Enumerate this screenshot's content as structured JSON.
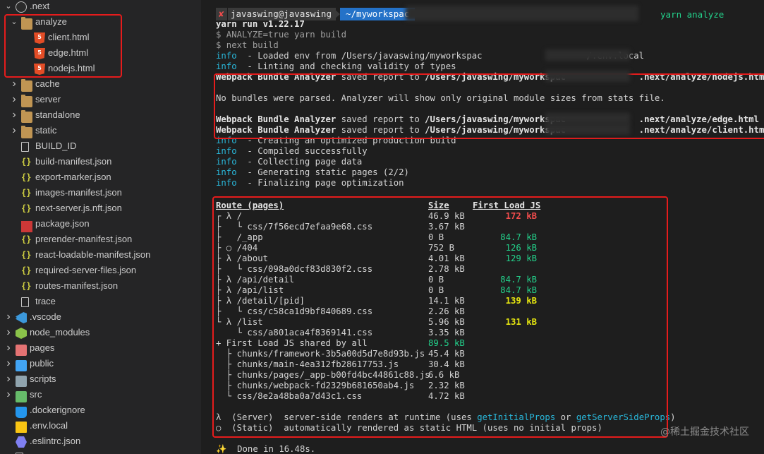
{
  "sidebar": {
    "root": ".next",
    "items": [
      {
        "label": ".next",
        "kind": "next",
        "indent": 0,
        "chevron": "down"
      },
      {
        "label": "analyze",
        "kind": "folder",
        "indent": 1,
        "chevron": "down"
      },
      {
        "label": "client.html",
        "kind": "html",
        "indent": 2,
        "chevron": ""
      },
      {
        "label": "edge.html",
        "kind": "html",
        "indent": 2,
        "chevron": ""
      },
      {
        "label": "nodejs.html",
        "kind": "html",
        "indent": 2,
        "chevron": ""
      },
      {
        "label": "cache",
        "kind": "folder",
        "indent": 1,
        "chevron": "right"
      },
      {
        "label": "server",
        "kind": "folder",
        "indent": 1,
        "chevron": "right"
      },
      {
        "label": "standalone",
        "kind": "folder",
        "indent": 1,
        "chevron": "right"
      },
      {
        "label": "static",
        "kind": "folder",
        "indent": 1,
        "chevron": "right"
      },
      {
        "label": "BUILD_ID",
        "kind": "file",
        "indent": 1,
        "chevron": ""
      },
      {
        "label": "build-manifest.json",
        "kind": "json",
        "indent": 1,
        "chevron": ""
      },
      {
        "label": "export-marker.json",
        "kind": "json",
        "indent": 1,
        "chevron": ""
      },
      {
        "label": "images-manifest.json",
        "kind": "json",
        "indent": 1,
        "chevron": ""
      },
      {
        "label": "next-server.js.nft.json",
        "kind": "json",
        "indent": 1,
        "chevron": ""
      },
      {
        "label": "package.json",
        "kind": "npm",
        "indent": 1,
        "chevron": ""
      },
      {
        "label": "prerender-manifest.json",
        "kind": "json",
        "indent": 1,
        "chevron": ""
      },
      {
        "label": "react-loadable-manifest.json",
        "kind": "json",
        "indent": 1,
        "chevron": ""
      },
      {
        "label": "required-server-files.json",
        "kind": "json",
        "indent": 1,
        "chevron": ""
      },
      {
        "label": "routes-manifest.json",
        "kind": "json",
        "indent": 1,
        "chevron": ""
      },
      {
        "label": "trace",
        "kind": "file",
        "indent": 1,
        "chevron": ""
      },
      {
        "label": ".vscode",
        "kind": "vscode",
        "indent": 0,
        "chevron": "right"
      },
      {
        "label": "node_modules",
        "kind": "nm",
        "indent": 0,
        "chevron": "right"
      },
      {
        "label": "pages",
        "kind": "redfolder",
        "indent": 0,
        "chevron": "right"
      },
      {
        "label": "public",
        "kind": "bluefolder",
        "indent": 0,
        "chevron": "right"
      },
      {
        "label": "scripts",
        "kind": "greyfolder",
        "indent": 0,
        "chevron": "right"
      },
      {
        "label": "src",
        "kind": "greenfolder",
        "indent": 0,
        "chevron": "right"
      },
      {
        "label": ".dockerignore",
        "kind": "docker",
        "indent": 0,
        "chevron": ""
      },
      {
        "label": ".env.local",
        "kind": "env",
        "indent": 0,
        "chevron": ""
      },
      {
        "label": ".eslintrc.json",
        "kind": "eslint",
        "indent": 0,
        "chevron": ""
      },
      {
        "label": "...",
        "kind": "file",
        "indent": 0,
        "chevron": ""
      }
    ]
  },
  "terminal": {
    "prompt": {
      "status": "✘",
      "user": "javaswing@javaswing",
      "dir": "~/myworkspac",
      "command": "yarn analyze"
    },
    "lines": [
      {
        "text": "yarn run v1.22.17",
        "cls": "bold"
      },
      {
        "text": "$ ANALYZE=true yarn build",
        "cls": "dim"
      },
      {
        "text": "$ next build",
        "cls": "dim"
      },
      {
        "prefix": "info",
        "text": "  - Loaded env from /Users/javaswing/myworkspac                    /.env.local"
      },
      {
        "prefix": "info",
        "text": "  - Linting and checking validity of types"
      },
      {
        "bold": "Webpack Bundle Analyzer",
        "text": " saved report to ",
        "path": "/Users/javaswing/myworkspac              .next/analyze/nodejs.html"
      },
      {
        "text": ""
      },
      {
        "text": "No bundles were parsed. Analyzer will show only original module sizes from stats file."
      },
      {
        "text": ""
      },
      {
        "bold": "Webpack Bundle Analyzer",
        "text": " saved report to ",
        "path": "/Users/javaswing/myworkspac              .next/analyze/edge.html"
      },
      {
        "bold": "Webpack Bundle Analyzer",
        "text": " saved report to ",
        "path": "/Users/javaswing/myworkspac              .next/analyze/client.html"
      },
      {
        "prefix": "info",
        "text": "  - Creating an optimized production build"
      },
      {
        "prefix": "info",
        "text": "  - Compiled successfully"
      },
      {
        "prefix": "info",
        "text": "  - Collecting page data"
      },
      {
        "prefix": "info",
        "text": "  - Generating static pages (2/2)"
      },
      {
        "prefix": "info",
        "text": "  - Finalizing page optimization"
      }
    ],
    "route_header": {
      "route": "Route (pages)",
      "size": "Size",
      "first_load": "First Load JS"
    },
    "routes": [
      {
        "tree": "┌ λ /",
        "size": "46.9 kB",
        "fl": "172 kB",
        "flc": "redtxt"
      },
      {
        "tree": "├   └ css/7f56ecd7efaa9e68.css",
        "size": "3.67 kB",
        "fl": "",
        "flc": ""
      },
      {
        "tree": "├   /_app",
        "size": "0 B",
        "fl": "84.7 kB",
        "flc": "green"
      },
      {
        "tree": "├ ○ /404",
        "size": "752 B",
        "fl": "126 kB",
        "flc": "green"
      },
      {
        "tree": "├ λ /about",
        "size": "4.01 kB",
        "fl": "129 kB",
        "flc": "green"
      },
      {
        "tree": "├   └ css/098a0dcf83d830f2.css",
        "size": "2.78 kB",
        "fl": "",
        "flc": ""
      },
      {
        "tree": "├ λ /api/detail",
        "size": "0 B",
        "fl": "84.7 kB",
        "flc": "green"
      },
      {
        "tree": "├ λ /api/list",
        "size": "0 B",
        "fl": "84.7 kB",
        "flc": "green"
      },
      {
        "tree": "├ λ /detail/[pid]",
        "size": "14.1 kB",
        "fl": "139 kB",
        "flc": "yellow"
      },
      {
        "tree": "├   └ css/c58ca1d9bf840689.css",
        "size": "2.26 kB",
        "fl": "",
        "flc": ""
      },
      {
        "tree": "└ λ /list",
        "size": "5.96 kB",
        "fl": "131 kB",
        "flc": "yellow"
      },
      {
        "tree": "    └ css/a801aca4f8369141.css",
        "size": "3.35 kB",
        "fl": "",
        "flc": ""
      },
      {
        "tree": "+ First Load JS shared by all",
        "size": "89.5 kB",
        "fl": "",
        "flc": "",
        "sizec": "green"
      },
      {
        "tree": "  ├ chunks/framework-3b5a00d5d7e8d93b.js",
        "size": "45.4 kB",
        "fl": "",
        "flc": ""
      },
      {
        "tree": "  ├ chunks/main-4ea312fb28617753.js",
        "size": "30.4 kB",
        "fl": "",
        "flc": ""
      },
      {
        "tree": "  ├ chunks/pages/_app-b00fd4bc44861c88.js",
        "size": "6.6 kB",
        "fl": "",
        "flc": ""
      },
      {
        "tree": "  ├ chunks/webpack-fd2329b681650ab4.js",
        "size": "2.32 kB",
        "fl": "",
        "flc": ""
      },
      {
        "tree": "  └ css/8e2a48ba0a7d43c1.css",
        "size": "4.72 kB",
        "fl": "",
        "flc": ""
      }
    ],
    "legend": [
      {
        "sym": "λ",
        "label": "(Server)",
        "text": "  server-side renders at runtime (uses ",
        "h1": "getInitialProps",
        "mid": " or ",
        "h2": "getServerSideProps",
        "end": ")"
      },
      {
        "sym": "○",
        "label": "(Static)",
        "text": "  automatically rendered as static HTML (uses no initial props)",
        "h1": "",
        "mid": "",
        "h2": "",
        "end": ""
      }
    ],
    "done": "✨  Done in 16.48s."
  },
  "watermark": "@稀土掘金技术社区",
  "colors": {
    "highlight": "#e51c1c",
    "info": "#29b8db",
    "green": "#23d18b",
    "yellow": "#e5e510",
    "red": "#f14c4c"
  }
}
